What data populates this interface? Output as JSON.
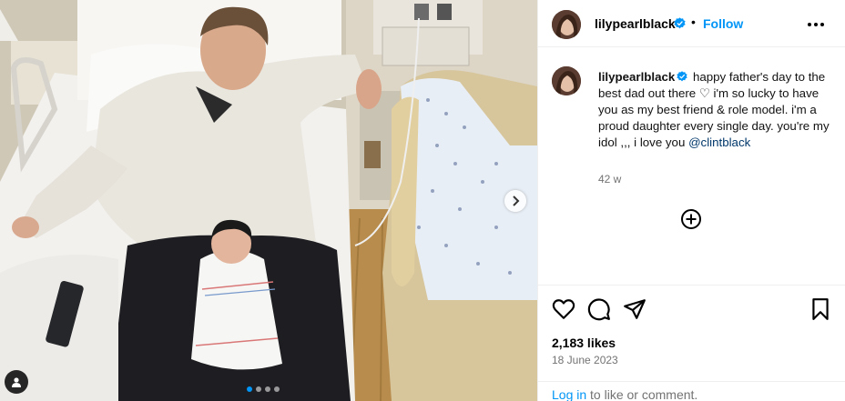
{
  "post": {
    "username": "lilypearlblack",
    "separator": "•",
    "follow_label": "Follow",
    "caption": {
      "username": "lilypearlblack",
      "text": "happy father's day to the best dad out there ♡ i'm so lucky to have you as my best friend & role model. i'm a proud daughter every single day. you're my idol ,,, i love you",
      "mention": "@clintblack"
    },
    "time_ago": "42 w",
    "likes": "2,183 likes",
    "date": "18 June 2023",
    "login": {
      "link": "Log in",
      "rest": "to like or comment."
    },
    "carousel": {
      "count": 4,
      "active_index": 0
    }
  },
  "icons": {
    "verified": "verified-badge-icon",
    "more": "more-options-icon",
    "add_comment": "plus-circle-icon",
    "like": "heart-icon",
    "comment": "comment-bubble-icon",
    "share": "paper-plane-icon",
    "save": "bookmark-icon",
    "next": "chevron-right-icon",
    "tags": "user-tag-icon"
  },
  "colors": {
    "link_blue": "#0095f6",
    "mention_blue": "#00376b",
    "muted": "#737373",
    "border": "#efefef"
  }
}
